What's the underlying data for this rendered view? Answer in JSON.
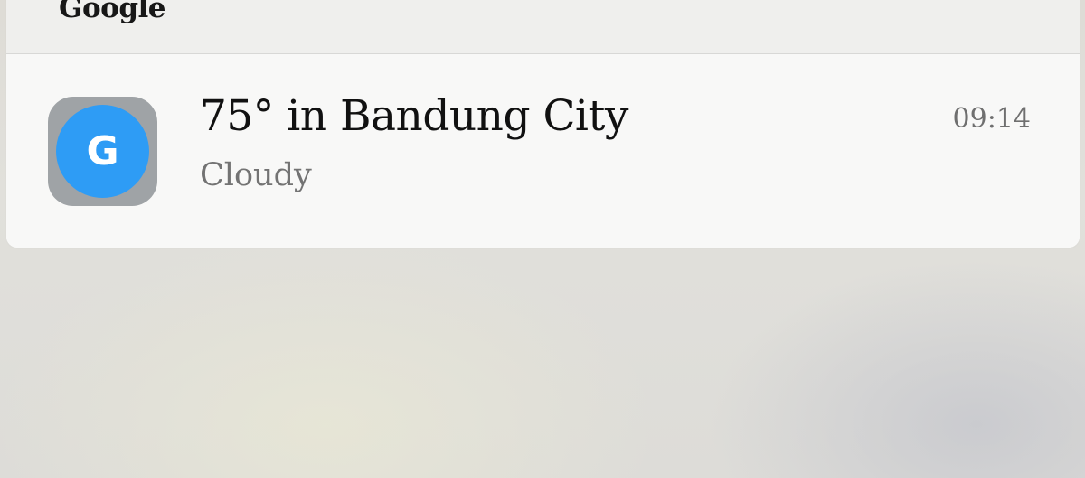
{
  "notification": {
    "app_name": "Google",
    "icon": {
      "name": "google-icon",
      "glyph": "G",
      "outer_color": "#9fa3a6",
      "inner_color": "#2e9cf5"
    },
    "title": "75° in Bandung City",
    "subtitle": "Cloudy",
    "time": "09:14"
  }
}
